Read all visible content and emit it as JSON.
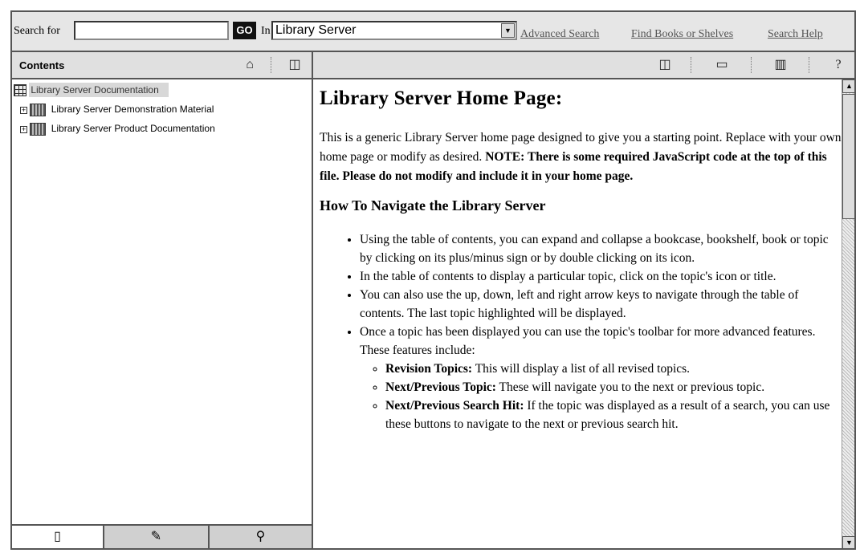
{
  "search": {
    "label": "Search for",
    "value": "",
    "go_label": "GO",
    "in_label": "In",
    "scope_value": "Library Server",
    "links": [
      "Advanced Search",
      "Find Books or Shelves",
      "Search Help"
    ]
  },
  "left": {
    "title": "Contents",
    "tree": [
      {
        "label": "Library Server Documentation",
        "selected": true
      },
      {
        "label": "Library Server Demonstration Material"
      },
      {
        "label": "Library Server Product Documentation"
      }
    ]
  },
  "content": {
    "page_title": "Library Server Home Page:",
    "intro_plain": "This is a generic Library Server home page designed to give you a starting point. Replace with your own home page or modify as desired.",
    "intro_bold": "NOTE: There is some required JavaScript code at the top of this file. Please do not modify and include it in your home page.",
    "section_title": "How To Navigate the Library Server",
    "bullets": [
      "Using the table of contents, you can expand and collapse a bookcase, bookshelf, book or topic by clicking on its plus/minus sign or by double clicking on its icon.",
      "In the table of contents to display a particular topic, click on the topic's icon or title.",
      "You can also use the up, down, left and right arrow keys to navigate through the table of contents. The last topic highlighted will be displayed.",
      "Once a topic has been displayed you can use the topic's toolbar for more advanced features. These features include:"
    ],
    "sub_bullets": [
      {
        "term": "Revision Topics:",
        "text": " This will display a list of all revised topics."
      },
      {
        "term": "Next/Previous Topic:",
        "text": " These will navigate you to the next or previous topic."
      },
      {
        "term": "Next/Previous Search Hit:",
        "text": " If the topic was displayed as a result of a search, you can use these buttons to navigate to the next or previous search hit."
      }
    ]
  },
  "icons": {
    "home": "home-icon",
    "sync": "sync-toc-icon",
    "tabs": [
      "contents-tab-icon",
      "search-results-tab-icon",
      "bookmarks-tab-icon"
    ],
    "toolbar": [
      "show-toc-icon",
      "new-window-icon",
      "print-icon",
      "help-icon"
    ]
  }
}
